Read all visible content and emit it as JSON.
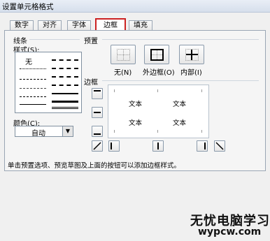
{
  "window": {
    "title": "设置单元格格式"
  },
  "tabs": [
    {
      "label": "数字"
    },
    {
      "label": "对齐"
    },
    {
      "label": "字体"
    },
    {
      "label": "边框",
      "active": true
    },
    {
      "label": "填充"
    }
  ],
  "line_section": {
    "title": "线条",
    "style_label": "样式(S):",
    "none_label": "无",
    "color_label": "颜色(C):",
    "color_value": "自动"
  },
  "presets": {
    "title": "预置",
    "none": "无(N)",
    "outline": "外边框(O)",
    "inside": "内部(I)"
  },
  "border": {
    "title": "边框",
    "preview_text": [
      "文本",
      "文本",
      "文本",
      "文本"
    ]
  },
  "hint": "单击预置选项、预览草图及上面的按钮可以添加边框样式。",
  "watermark": {
    "line1": "无忧电脑学习网",
    "line2": "wypcw.com"
  }
}
